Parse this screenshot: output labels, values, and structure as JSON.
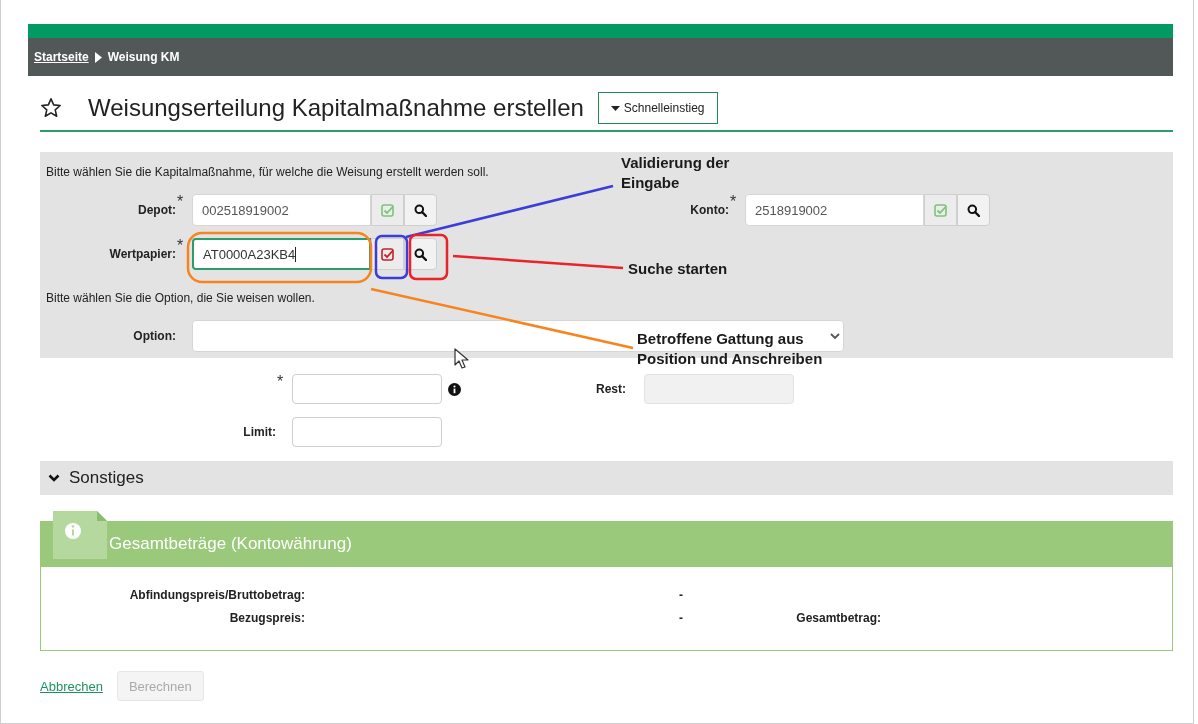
{
  "breadcrumb": [
    {
      "label": "Startseite",
      "link": true
    },
    {
      "label": "Weisung KM",
      "link": false
    }
  ],
  "page_title": "Weisungserteilung Kapitalmaßnahme erstellen",
  "quick_access_button": "Schnelleinstieg",
  "selection_panel": {
    "intro": "Bitte wählen Sie die Kapitalmaßnahme, für welche die Weisung erstellt werden soll.",
    "fields": [
      {
        "label": "Depot:",
        "required_mark": "*",
        "value": "002518919002",
        "valid": true,
        "focused": false
      },
      {
        "label": "Konto:",
        "required_mark": "*",
        "value": "2518919002",
        "valid": true,
        "focused": false
      },
      {
        "label": "Wertpapier:",
        "required_mark": "*",
        "value": "AT0000A23KB4",
        "valid": false,
        "focused": true
      }
    ],
    "option_intro": "Bitte wählen Sie die Option, die Sie weisen wollen.",
    "option": {
      "label": "Option:"
    }
  },
  "amount_field": {
    "required_mark": "*"
  },
  "rest_field": {
    "label": "Rest:",
    "disabled": true
  },
  "limit_field": {
    "label": "Limit:",
    "disabled": false
  },
  "other_section": {
    "title": "Sonstiges"
  },
  "totals_panel": {
    "title": "Gesamtbeträge (Kontowährung)",
    "items": [
      {
        "label": "Abfindungspreis/Bruttobetrag:",
        "value": "-"
      },
      {
        "label": "Bezugspreis:",
        "value": "-"
      },
      {
        "label": "Gesamtbetrag:"
      }
    ]
  },
  "actions": {
    "cancel": "Abbrechen",
    "calculate": {
      "label": "Berechnen",
      "disabled": true
    }
  },
  "annotations": [
    {
      "text": "Validierung der Eingabe",
      "color": "#3c3cd8"
    },
    {
      "text": "Suche starten",
      "color": "#e8232a"
    },
    {
      "text": "Betroffene Gattung aus Position und Anschreiben",
      "color": "#f7841f"
    }
  ]
}
